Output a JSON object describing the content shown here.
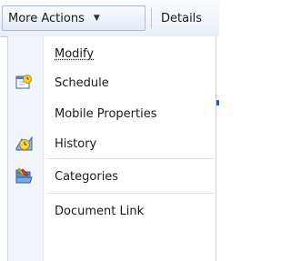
{
  "toolbar": {
    "more_actions_label": "More Actions",
    "details_label": "Details"
  },
  "menu": {
    "items": [
      {
        "label": "Modify",
        "icon": "none"
      },
      {
        "label": "Schedule",
        "icon": "schedule-icon"
      },
      {
        "label": "Mobile Properties",
        "icon": "none"
      },
      {
        "label": "History",
        "icon": "history-icon"
      },
      {
        "label": "Categories",
        "icon": "categories-icon"
      },
      {
        "label": "Document Link",
        "icon": "none"
      }
    ]
  },
  "colors": {
    "toolbar_bg": "#e9eef6",
    "menu_gutter": "#f2f5f9",
    "accent": "#2d5ea8"
  }
}
